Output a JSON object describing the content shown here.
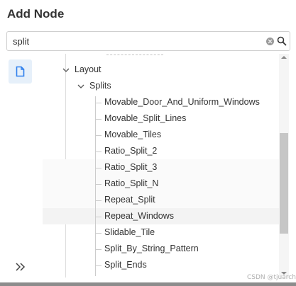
{
  "panel": {
    "title": "Add Node",
    "search": {
      "value": "split",
      "placeholder": ""
    },
    "sidebar": {
      "node_button_icon": "document-icon",
      "expand_icon": "double-chevron-right-icon"
    }
  },
  "tree": {
    "parent": {
      "label": "Layout",
      "state": "expanded"
    },
    "group": {
      "label": "Splits",
      "state": "expanded"
    },
    "items": [
      "Movable_Door_And_Uniform_Windows",
      "Movable_Split_Lines",
      "Movable_Tiles",
      "Ratio_Split_2",
      "Ratio_Split_3",
      "Ratio_Split_N",
      "Repeat_Split",
      "Repeat_Windows",
      "Slidable_Tile",
      "Split_By_String_Pattern",
      "Split_Ends"
    ]
  },
  "watermark": "CSDN @tjuarch",
  "colors": {
    "accent_bg": "#e6f0fa",
    "accent_icon": "#2f80ed",
    "hover_row": "#f3f3f3",
    "scroll_thumb": "#c6c6c6"
  }
}
